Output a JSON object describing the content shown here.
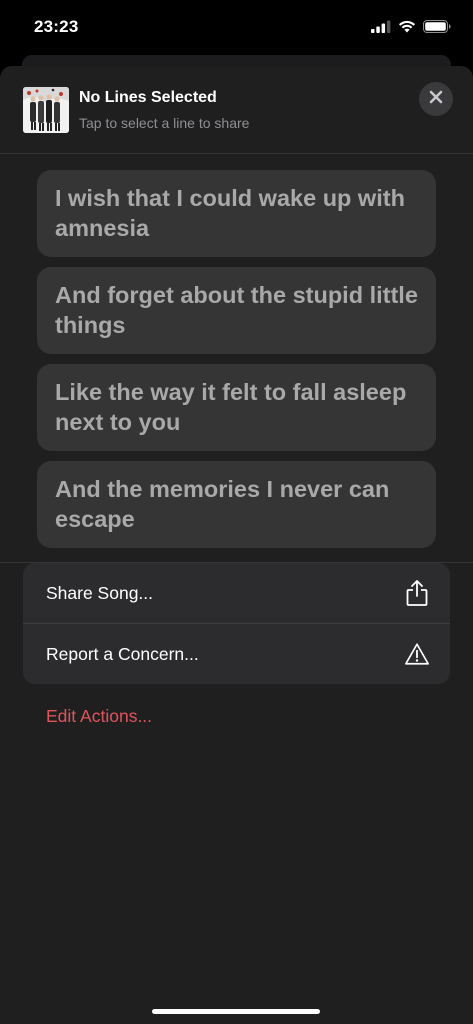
{
  "status_bar": {
    "time": "23:23",
    "icons": [
      "cellular-signal-icon",
      "wifi-icon",
      "battery-icon"
    ]
  },
  "header": {
    "title": "No Lines Selected",
    "subtitle": "Tap to select a line to share",
    "album_art_icon": "album-art-thumbnail",
    "close_icon": "close-icon"
  },
  "lyrics": [
    {
      "text": "I wish that I could wake up with amnesia"
    },
    {
      "text": "And forget about the stupid little things"
    },
    {
      "text": "Like the way it felt to fall asleep next to you"
    },
    {
      "text": "And the memories I never can escape"
    }
  ],
  "actions": [
    {
      "label": "Share Song...",
      "icon": "share-icon"
    },
    {
      "label": "Report a Concern...",
      "icon": "warning-icon"
    }
  ],
  "edit_actions_label": "Edit Actions...",
  "colors": {
    "sheet_background": "#1f1f1f",
    "card_background": "#353535",
    "lyric_text": "#a9a9a9",
    "accent_red": "#e0545e"
  }
}
